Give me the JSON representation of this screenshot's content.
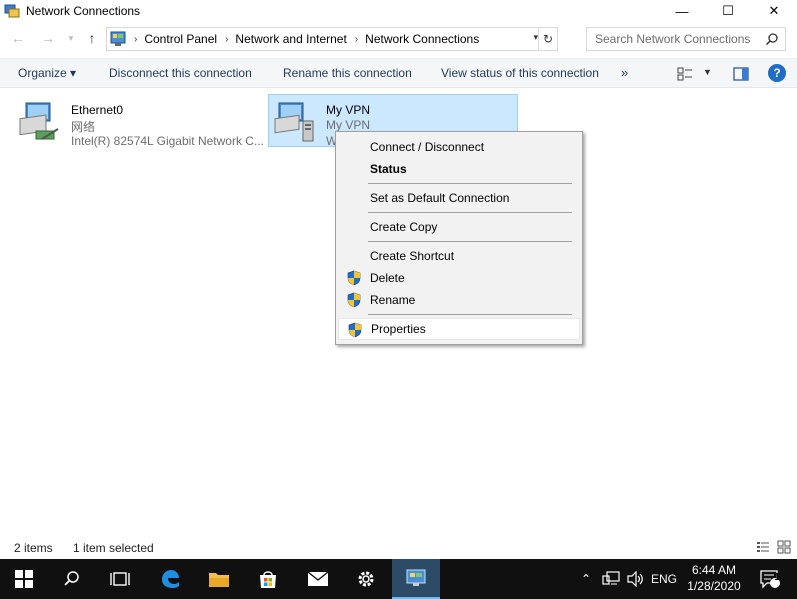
{
  "window": {
    "title": "Network Connections",
    "minimize": "—",
    "maximize": "☐",
    "close": "✕"
  },
  "address": {
    "crumbs": [
      "Control Panel",
      "Network and Internet",
      "Network Connections"
    ]
  },
  "search": {
    "placeholder": "Search Network Connections"
  },
  "commands": {
    "organize": "Organize ▾",
    "disconnect": "Disconnect this connection",
    "rename": "Rename this connection",
    "view_status": "View status of this connection",
    "more": "»"
  },
  "items": [
    {
      "name": "Ethernet0",
      "network": "网络",
      "device": "Intel(R) 82574L Gigabit Network C..."
    },
    {
      "name": "My VPN",
      "network": "My VPN",
      "device": "W"
    }
  ],
  "context_menu": {
    "connect": "Connect / Disconnect",
    "status": "Status",
    "set_default": "Set as Default Connection",
    "create_copy": "Create Copy",
    "create_shortcut": "Create Shortcut",
    "delete": "Delete",
    "rename": "Rename",
    "properties": "Properties"
  },
  "statusbar": {
    "count": "2 items",
    "selected": "1 item selected"
  },
  "taskbar": {
    "language": "ENG",
    "time": "6:44 AM",
    "date": "1/28/2020",
    "notifications": "1"
  },
  "colors": {
    "selection": "#cce8ff",
    "selection_border": "#99d1ff",
    "taskbar": "#101010",
    "accent": "#1f6dc8"
  }
}
